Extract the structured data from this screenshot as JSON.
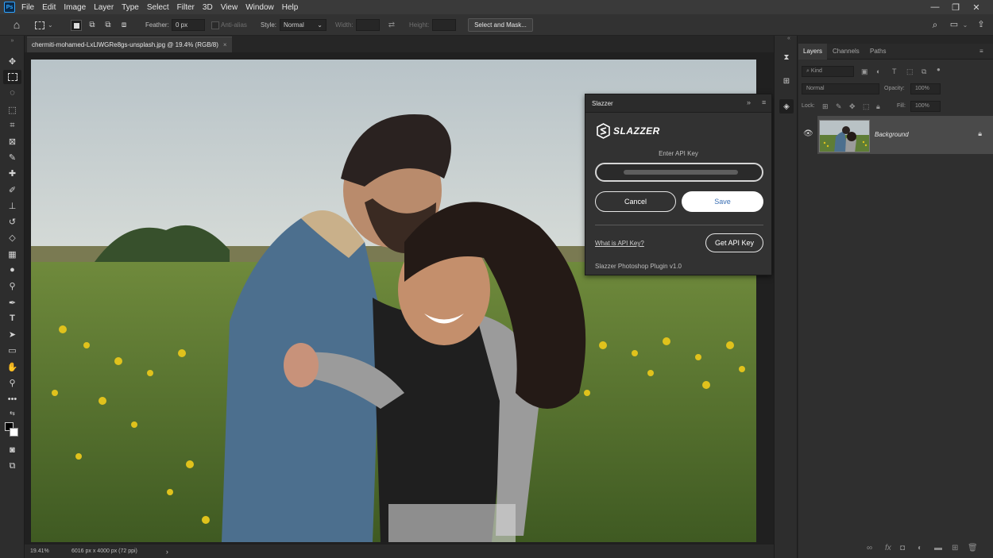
{
  "app": {
    "logo_text": "Ps",
    "menu": [
      "File",
      "Edit",
      "Image",
      "Layer",
      "Type",
      "Select",
      "Filter",
      "3D",
      "View",
      "Window",
      "Help"
    ]
  },
  "options": {
    "feather_label": "Feather:",
    "feather_value": "0 px",
    "antialias_label": "Anti-alias",
    "style_label": "Style:",
    "style_value": "Normal",
    "width_label": "Width:",
    "height_label": "Height:",
    "select_mask_label": "Select and Mask..."
  },
  "document": {
    "tab_title": "chermiti-mohamed-LxLlWGRe8gs-unsplash.jpg @ 19.4% (RGB/8)",
    "tab_close": "×",
    "zoom": "19.41%",
    "dimensions": "6016 px x 4000 px (72 ppi)",
    "status_arrow": "›"
  },
  "slazzer": {
    "panel_title": "Slazzer",
    "logo_word": "SLAZZER",
    "prompt": "Enter API Key",
    "cancel_label": "Cancel",
    "save_label": "Save",
    "what_is_link": "What is API Key?",
    "get_key_label": "Get API Key",
    "version": "Slazzer Photoshop Plugin v1.0"
  },
  "layers_panel": {
    "tabs": [
      "Layers",
      "Channels",
      "Paths"
    ],
    "kind_placeholder": "Kind",
    "blend_mode": "Normal",
    "opacity_label": "Opacity:",
    "opacity_value": "100%",
    "lock_label": "Lock:",
    "fill_label": "Fill:",
    "fill_value": "100%",
    "layers": [
      {
        "name": "Background",
        "visible": true,
        "locked": true
      }
    ]
  },
  "colors": {
    "accent": "#31a8ff",
    "panel_bg": "#323232",
    "save_text": "#3b6fb4"
  }
}
